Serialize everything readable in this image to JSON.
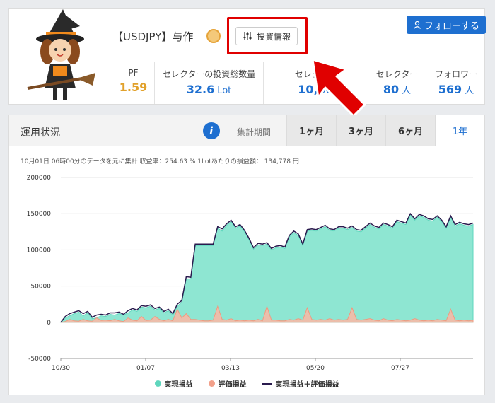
{
  "strategy": {
    "name": "【USDJPY】与作",
    "invest_info_label": "投資情報",
    "follow_label": "フォローする",
    "medal_icon": "medal-icon",
    "accent": "#1e6fd0",
    "pf_color": "#e1a12b"
  },
  "stats": [
    {
      "label": "PF",
      "value": "1.59",
      "unit": ""
    },
    {
      "label": "セレクターの投資総数量",
      "value": "32.6",
      "unit": "Lot"
    },
    {
      "label": "セレクター",
      "value": "10,00",
      "unit": ""
    },
    {
      "label": "セレクター",
      "value": "80",
      "unit": "人"
    },
    {
      "label": "フォロワー",
      "value": "569",
      "unit": "人"
    }
  ],
  "panel": {
    "title": "運用状況",
    "period_label": "集計期間",
    "tabs": [
      "1ヶ月",
      "3ヶ月",
      "6ヶ月",
      "1年"
    ],
    "active_tab": "1年",
    "caption": "10月01日 06時00分のデータを元に集計 収益率：254.63 % 1Lotあたりの損益額： 134,778 円"
  },
  "chart_data": {
    "type": "area",
    "xlabels": [
      "10/30",
      "01/07",
      "03/13",
      "05/20",
      "07/27"
    ],
    "ylim": [
      -50000,
      200000
    ],
    "yticks": [
      -50000,
      0,
      50000,
      100000,
      150000,
      200000
    ],
    "series": [
      {
        "name": "実現損益",
        "color": "#8ee6d2"
      },
      {
        "name": "評価損益",
        "color": "#f2a08a"
      },
      {
        "name": "実現損益＋評価損益",
        "color": "#2a1b4e"
      }
    ],
    "x": [
      0,
      4,
      8,
      12,
      16,
      20,
      24,
      28,
      32,
      36,
      40,
      44,
      48,
      52,
      56,
      60,
      64,
      68,
      72,
      76,
      80,
      84,
      88,
      92,
      96,
      100,
      104,
      108,
      112,
      116,
      120,
      124,
      128,
      132,
      136,
      140,
      144,
      148,
      152,
      156,
      160,
      164,
      168,
      172,
      176,
      180,
      184,
      188,
      192,
      196,
      200,
      204,
      208,
      212,
      216,
      220,
      224,
      228,
      232,
      236,
      240,
      244,
      248,
      252,
      256,
      260,
      264,
      268,
      272,
      276,
      280,
      284,
      288,
      292,
      296,
      300,
      304,
      308,
      312,
      316,
      320,
      324,
      328,
      332,
      336,
      340,
      344,
      348,
      352,
      356,
      360,
      364,
      368
    ],
    "realized": [
      0,
      6000,
      9000,
      12000,
      14000,
      9000,
      13000,
      5000,
      6000,
      9000,
      8000,
      11000,
      10000,
      12000,
      10000,
      13000,
      17000,
      15000,
      21000,
      20000,
      22000,
      17000,
      19000,
      13000,
      16000,
      10000,
      22000,
      28000,
      60000,
      60000,
      106000,
      106000,
      106000,
      106000,
      106000,
      130000,
      126000,
      134000,
      139000,
      130000,
      133000,
      125000,
      114000,
      101000,
      107000,
      106000,
      108000,
      100000,
      103000,
      104000,
      102000,
      118000,
      124000,
      120000,
      106000,
      126000,
      127000,
      126000,
      129000,
      132000,
      127000,
      126000,
      130000,
      130000,
      128000,
      131000,
      126000,
      125000,
      130000,
      135000,
      131000,
      129000,
      135000,
      133000,
      130000,
      139000,
      137000,
      135000,
      148000,
      141000,
      147000,
      145000,
      141000,
      140000,
      145000,
      139000,
      130000,
      145000,
      133000,
      136000,
      134000,
      133000,
      135000
    ],
    "unrealized": [
      0,
      1000,
      4000,
      2000,
      1500,
      4000,
      2000,
      1500,
      6000,
      2500,
      3000,
      2000,
      4000,
      2000,
      1000,
      6000,
      3000,
      2000,
      8000,
      2500,
      3000,
      8000,
      4000,
      2000,
      4000,
      2000,
      18000,
      6000,
      12000,
      4000,
      4000,
      3000,
      2000,
      2000,
      3000,
      22000,
      4000,
      3000,
      5000,
      2000,
      3000,
      2000,
      3000,
      2000,
      4000,
      2000,
      22000,
      3000,
      3000,
      2000,
      2000,
      4000,
      3000,
      5000,
      3000,
      20000,
      4000,
      3000,
      4000,
      3000,
      5000,
      3000,
      4000,
      3000,
      4000,
      20000,
      4000,
      3000,
      4000,
      5000,
      3000,
      2000,
      5000,
      3000,
      2000,
      4000,
      3000,
      2000,
      3000,
      5000,
      3000,
      2000,
      3000,
      2000,
      4000,
      3000,
      2000,
      18000,
      3000,
      2000,
      3000,
      2000,
      3000
    ],
    "total": [
      0,
      8000,
      12000,
      14000,
      16000,
      12000,
      15000,
      7000,
      10000,
      11000,
      10000,
      13000,
      13000,
      14000,
      11000,
      16000,
      19000,
      17000,
      23000,
      22000,
      24000,
      19000,
      21000,
      15000,
      18000,
      12000,
      25000,
      30000,
      63000,
      62000,
      108000,
      108000,
      108000,
      108000,
      108000,
      132000,
      129000,
      136000,
      141000,
      132000,
      135000,
      127000,
      116000,
      103000,
      109000,
      108000,
      110000,
      102000,
      105000,
      106000,
      104000,
      120000,
      126000,
      122000,
      108000,
      128000,
      129000,
      128000,
      131000,
      134000,
      129000,
      128000,
      132000,
      132000,
      130000,
      133000,
      128000,
      127000,
      132000,
      137000,
      133000,
      131000,
      137000,
      135000,
      132000,
      141000,
      139000,
      137000,
      150000,
      143000,
      149000,
      147000,
      143000,
      142000,
      147000,
      141000,
      132000,
      147000,
      135000,
      138000,
      136000,
      135000,
      137000
    ]
  }
}
